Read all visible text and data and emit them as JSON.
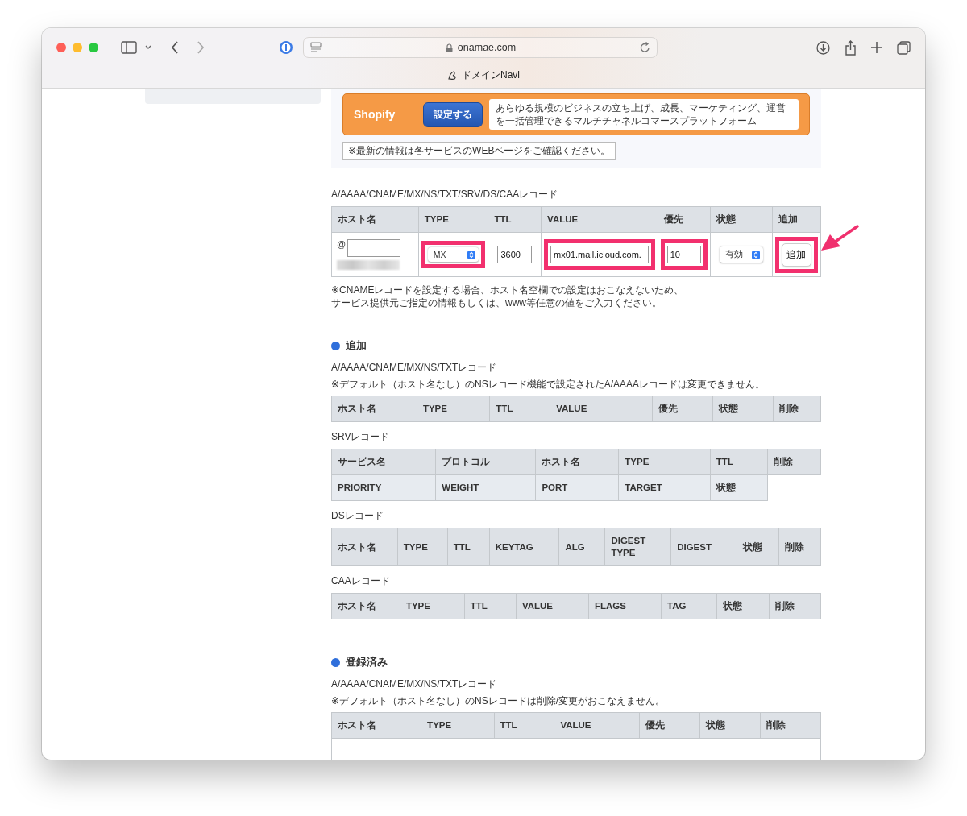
{
  "browser": {
    "url": "onamae.com",
    "tab_title": "ドメインNavi"
  },
  "banner": {
    "name": "Shopify",
    "button": "設定する",
    "description": "あらゆる規模のビジネスの立ち上げ、成長、マーケティング、運営を一括管理できるマルチチャネルコマースプラットフォーム"
  },
  "notice": "※最新の情報は各サービスのWEBページをご確認ください。",
  "add_form": {
    "title": "A/AAAA/CNAME/MX/NS/TXT/SRV/DS/CAAレコード",
    "columns": [
      "ホスト名",
      "TYPE",
      "TTL",
      "VALUE",
      "優先",
      "状態",
      "追加"
    ],
    "fields": [
      {
        "kind": "host",
        "prefix": "@",
        "highlighted": false
      },
      {
        "kind": "select",
        "value": "MX",
        "highlighted": true
      },
      {
        "kind": "text",
        "value": "3600",
        "highlighted": false
      },
      {
        "kind": "text",
        "value": "mx01.mail.icloud.com.",
        "highlighted": true
      },
      {
        "kind": "text",
        "value": "10",
        "highlighted": true
      },
      {
        "kind": "select",
        "value": "有効",
        "highlighted": false
      },
      {
        "kind": "button",
        "value": "追加",
        "highlighted": true
      }
    ],
    "notes": [
      "※CNAMEレコードを設定する場合、ホスト名空欄での設定はおこなえないため、",
      "サービス提供元ご指定の情報もしくは、www等任意の値をご入力ください。"
    ]
  },
  "sections": [
    {
      "heading": "追加",
      "tables": [
        {
          "title": "A/AAAA/CNAME/MX/NS/TXTレコード",
          "note": "※デフォルト（ホスト名なし）のNSレコード機能で設定されたA/AAAAレコードは変更できません。",
          "header_rows": [
            [
              "ホスト名",
              "TYPE",
              "TTL",
              "VALUE",
              "優先",
              "状態",
              "削除"
            ]
          ],
          "empty_row": false
        },
        {
          "title": "SRVレコード",
          "header_rows": [
            [
              "サービス名",
              "プロトコル",
              "ホスト名",
              "TYPE",
              "TTL",
              "削除"
            ],
            [
              "PRIORITY",
              "WEIGHT",
              "PORT",
              "TARGET",
              "状態"
            ]
          ],
          "empty_row": false
        },
        {
          "title": "DSレコード",
          "header_rows": [
            [
              "ホスト名",
              "TYPE",
              "TTL",
              "KEYTAG",
              "ALG",
              "DIGEST TYPE",
              "DIGEST",
              "状態",
              "削除"
            ]
          ],
          "empty_row": false
        },
        {
          "title": "CAAレコード",
          "header_rows": [
            [
              "ホスト名",
              "TYPE",
              "TTL",
              "VALUE",
              "FLAGS",
              "TAG",
              "状態",
              "削除"
            ]
          ],
          "empty_row": false
        }
      ]
    },
    {
      "heading": "登録済み",
      "tables": [
        {
          "title": "A/AAAA/CNAME/MX/NS/TXTレコード",
          "note": "※デフォルト（ホスト名なし）のNSレコードは削除/変更がおこなえません。",
          "header_rows": [
            [
              "ホスト名",
              "TYPE",
              "TTL",
              "VALUE",
              "優先",
              "状態",
              "削除"
            ]
          ],
          "empty_row": true
        }
      ]
    }
  ]
}
